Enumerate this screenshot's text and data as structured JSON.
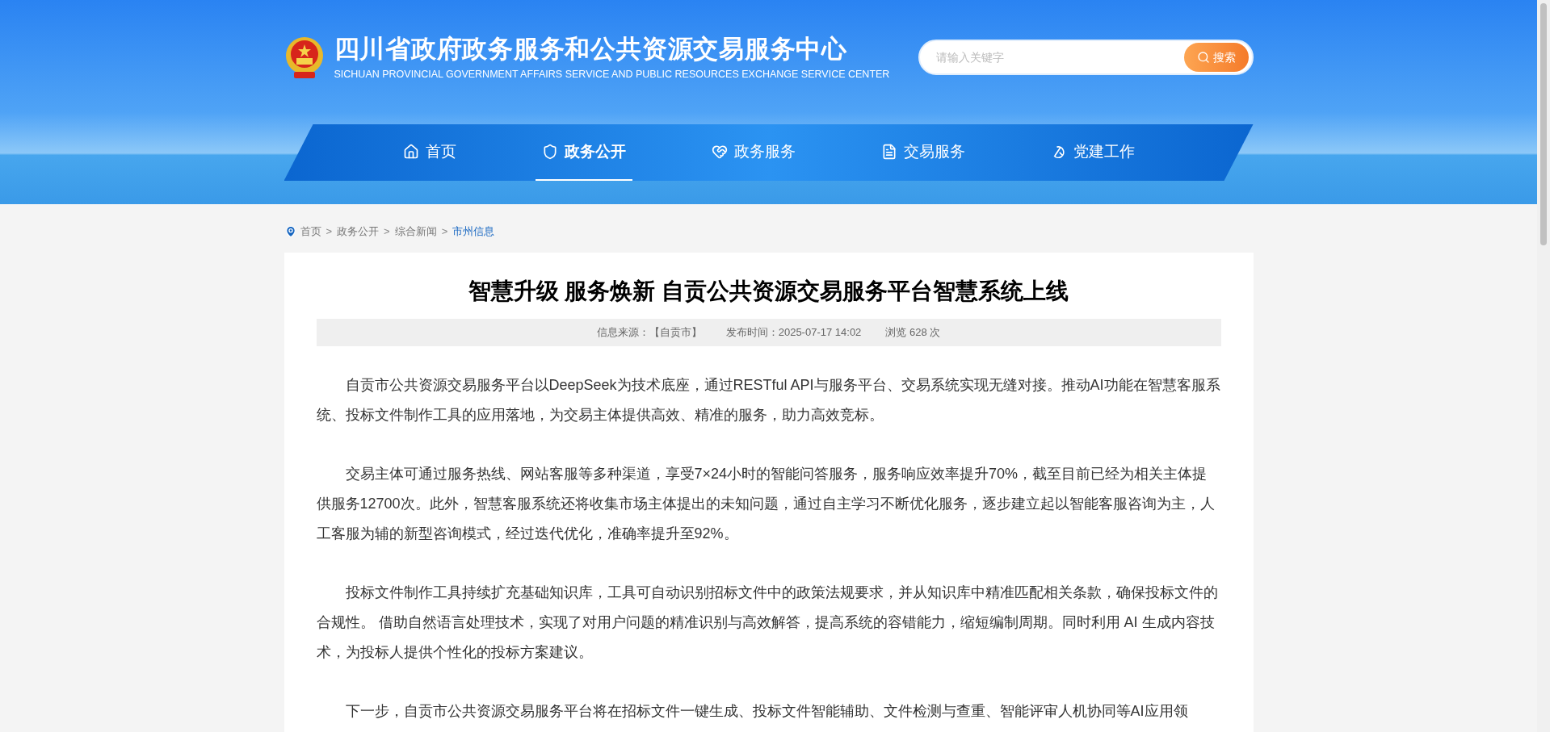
{
  "header": {
    "title": "四川省政府政务服务和公共资源交易服务中心",
    "subtitle": "SICHUAN PROVINCIAL GOVERNMENT AFFAIRS SERVICE AND PUBLIC RESOURCES EXCHANGE SERVICE CENTER",
    "search": {
      "placeholder": "请输入关键字",
      "button": "搜索"
    }
  },
  "nav": [
    {
      "label": "首页",
      "selected": false
    },
    {
      "label": "政务公开",
      "selected": true
    },
    {
      "label": "政务服务",
      "selected": false
    },
    {
      "label": "交易服务",
      "selected": false
    },
    {
      "label": "党建工作",
      "selected": false
    }
  ],
  "breadcrumb": {
    "separator": ">",
    "items": [
      {
        "label": "首页",
        "selected": false
      },
      {
        "label": "政务公开",
        "selected": false
      },
      {
        "label": "综合新闻",
        "selected": false
      },
      {
        "label": "市州信息",
        "selected": true
      }
    ]
  },
  "article": {
    "title": "智慧升级 服务焕新 自贡公共资源交易服务平台智慧系统上线",
    "meta": [
      "信息来源：【自贡市】",
      "发布时间：2025-07-17 14:02",
      "浏览 628 次"
    ],
    "paragraphs": [
      "自贡市公共资源交易服务平台以DeepSeek为技术底座，通过RESTful API与服务平台、交易系统实现无缝对接。推动AI功能在智慧客服系统、投标文件制作工具的应用落地，为交易主体提供高效、精准的服务，助力高效竞标。",
      "交易主体可通过服务热线、网站客服等多种渠道，享受7×24小时的智能问答服务，服务响应效率提升70%，截至目前已经为相关主体提供服务12700次。此外，智慧客服系统还将收集市场主体提出的未知问题，通过自主学习不断优化服务，逐步建立起以智能客服咨询为主，人工客服为辅的新型咨询模式，经过迭代优化，准确率提升至92%。",
      "投标文件制作工具持续扩充基础知识库，工具可自动识别招标文件中的政策法规要求，并从知识库中精准匹配相关条款，确保投标文件的合规性。 借助自然语言处理技术，实现了对用户问题的精准识别与高效解答，提高系统的容错能力，缩短编制周期。同时利用 AI 生成内容技术，为投标人提供个性化的投标方案建议。",
      "下一步，自贡市公共资源交易服务平台将在招标文件一键生成、投标文件智能辅助、文件检测与查重、智能评审人机协同等AI应用领"
    ]
  }
}
